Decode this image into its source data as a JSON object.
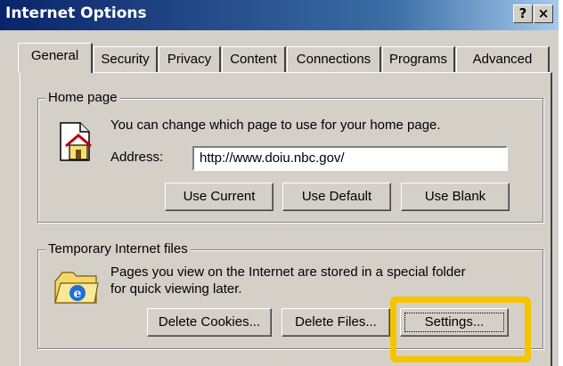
{
  "window": {
    "title": "Internet Options",
    "help_button": "?",
    "close_button": "×"
  },
  "tabs": [
    {
      "label": "General",
      "active": true
    },
    {
      "label": "Security"
    },
    {
      "label": "Privacy"
    },
    {
      "label": "Content"
    },
    {
      "label": "Connections"
    },
    {
      "label": "Programs"
    },
    {
      "label": "Advanced"
    }
  ],
  "home_page": {
    "legend": "Home page",
    "description": "You can change which page to use for your home page.",
    "address_label": "Address:",
    "address_value": "http://www.doiu.nbc.gov/",
    "use_current": "Use Current",
    "use_default": "Use Default",
    "use_blank": "Use Blank"
  },
  "temp_files": {
    "legend": "Temporary Internet files",
    "description_line1": "Pages you view on the Internet are stored in a special folder",
    "description_line2": "for quick viewing later.",
    "delete_cookies": "Delete Cookies...",
    "delete_files": "Delete Files...",
    "settings": "Settings..."
  },
  "colors": {
    "highlight": "#f5c400",
    "titlebar": "#0a246a",
    "face": "#d4d0c8"
  }
}
